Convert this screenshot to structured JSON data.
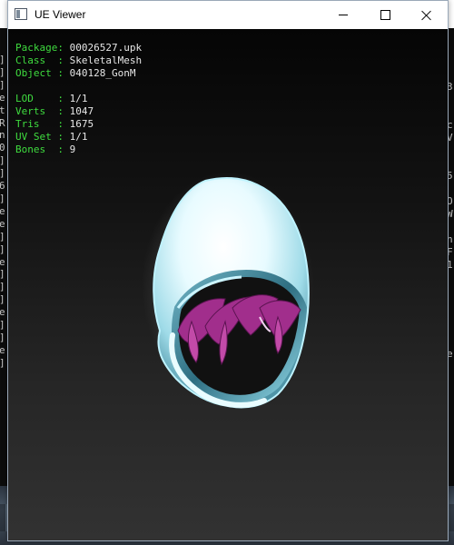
{
  "window": {
    "title": "UE Viewer"
  },
  "info": {
    "package_key": "Package:",
    "package_value": "00026527.upk",
    "class_key": "Class  :",
    "class_value": "SkeletalMesh",
    "object_key": "Object :",
    "object_value": "040128_GonM",
    "lod_key": "LOD    :",
    "lod_value": "1/1",
    "verts_key": "Verts  :",
    "verts_value": "1047",
    "tris_key": "Tris   :",
    "tris_value": "1675",
    "uvset_key": "UV Set :",
    "uvset_value": "1/1",
    "bones_key": "Bones  :",
    "bones_value": "9"
  },
  "background": {
    "left_console": "]\n]\n]\ne\nt\nR\nn\n0\n]\n]\n6\n]\ne\ne\n]\n]\ne\n]\n]\n]\ne\n]\n]\ne\n]",
    "right_console": "3\n\n\nc\nV\n\n\n5\n\nO\nW\n\nn\nF\n1\n\n\n\n\n\n\ne"
  }
}
